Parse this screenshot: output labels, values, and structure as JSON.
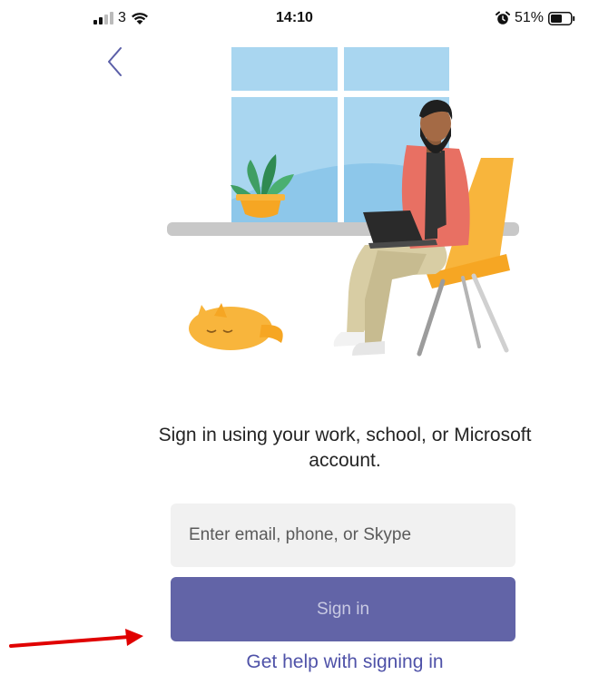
{
  "status_bar": {
    "carrier": "3",
    "time": "14:10",
    "battery_percent": "51%",
    "icons": [
      "signal-icon",
      "wifi-icon",
      "alarm-icon",
      "battery-icon"
    ]
  },
  "navigation": {
    "back_icon": "chevron-left-icon"
  },
  "illustration": {
    "description_icon": "person-working-on-laptop-illustration"
  },
  "signin": {
    "prompt": "Sign in using your work, school, or Microsoft account.",
    "email_placeholder": "Enter email, phone, or Skype",
    "email_value": "",
    "sign_in_label": "Sign in",
    "help_link": "Get help with signing in"
  },
  "colors": {
    "accent": "#6264a7",
    "link": "#4f52a8",
    "annotation": "#e00000"
  }
}
